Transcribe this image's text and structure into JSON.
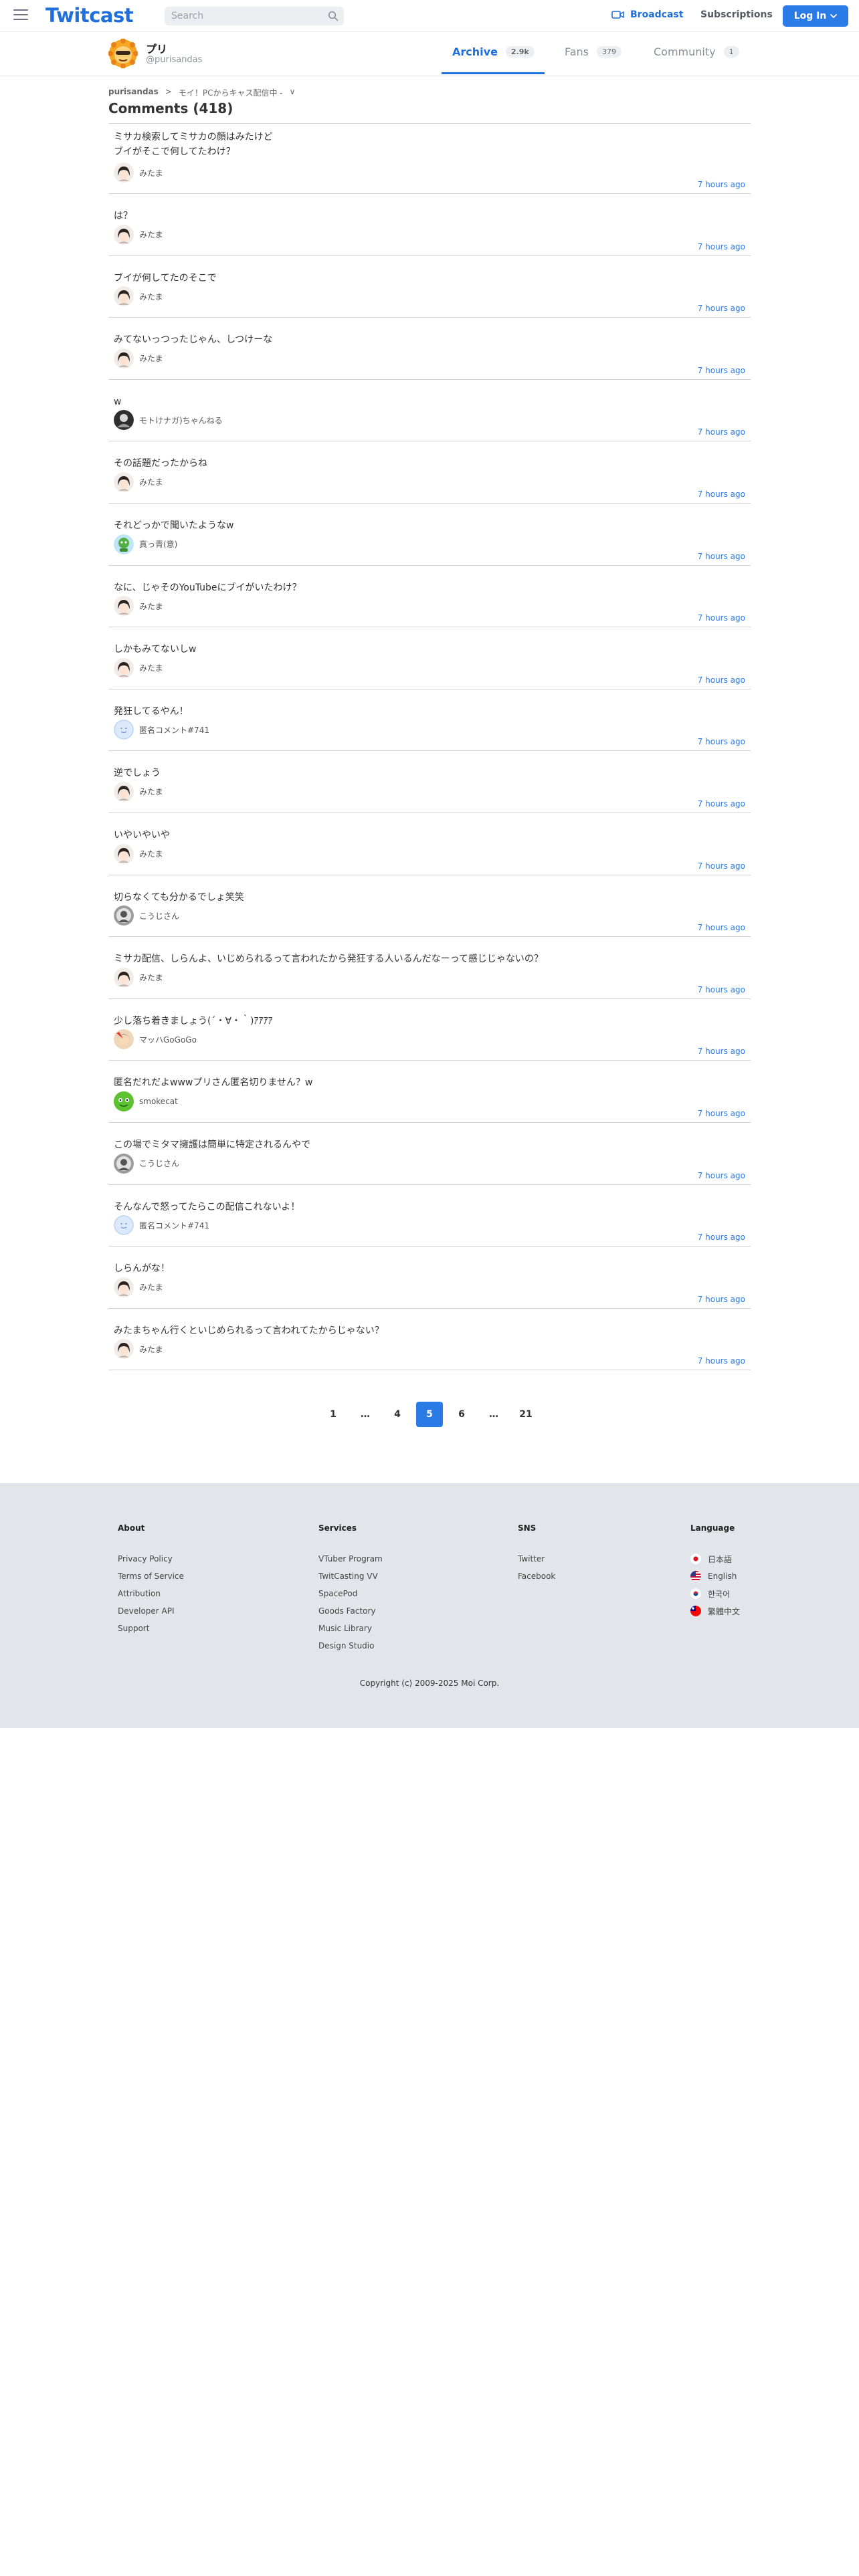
{
  "header": {
    "logo": "Twitcast",
    "search_placeholder": "Search",
    "broadcast_label": "Broadcast",
    "subscriptions_label": "Subscriptions",
    "login_label": "Log In"
  },
  "profile": {
    "name": "プリ",
    "handle": "@purisandas",
    "tabs": [
      {
        "label": "Archive",
        "count": "2.9k"
      },
      {
        "label": "Fans",
        "count": "379"
      },
      {
        "label": "Community",
        "count": "1"
      }
    ]
  },
  "breadcrumb": {
    "user": "purisandas",
    "separator": ">",
    "title": "モイ！PCからキャス配信中 -",
    "chevron": "∨"
  },
  "page_title": "Comments (418)",
  "comments": [
    {
      "text": "ミサカ検索してミサカの顔はみたけど\nブイがそこで何してたわけ？",
      "author": "みたま",
      "time": "7 hours ago",
      "avatar": "mitama"
    },
    {
      "text": "は？",
      "author": "みたま",
      "time": "7 hours ago",
      "avatar": "mitama"
    },
    {
      "text": "ブイが何してたのそこで",
      "author": "みたま",
      "time": "7 hours ago",
      "avatar": "mitama"
    },
    {
      "text": "みてないっつったじゃん、しつけーな",
      "author": "みたま",
      "time": "7 hours ago",
      "avatar": "mitama"
    },
    {
      "text": "w",
      "author": "モトけナガ)ちゃんねる",
      "time": "7 hours ago",
      "avatar": "moto"
    },
    {
      "text": "その話題だったからね",
      "author": "みたま",
      "time": "7 hours ago",
      "avatar": "mitama"
    },
    {
      "text": "それどっかで聞いたようなw",
      "author": "真っ青(意)",
      "time": "7 hours ago",
      "avatar": "massao"
    },
    {
      "text": "なに、じゃそのYouTubeにブイがいたわけ？",
      "author": "みたま",
      "time": "7 hours ago",
      "avatar": "mitama"
    },
    {
      "text": "しかもみてないしw",
      "author": "みたま",
      "time": "7 hours ago",
      "avatar": "mitama"
    },
    {
      "text": "発狂してるやん！",
      "author": "匿名コメント#741",
      "time": "7 hours ago",
      "avatar": "anon"
    },
    {
      "text": "逆でしょう",
      "author": "みたま",
      "time": "7 hours ago",
      "avatar": "mitama"
    },
    {
      "text": "いやいやいや",
      "author": "みたま",
      "time": "7 hours ago",
      "avatar": "mitama"
    },
    {
      "text": "切らなくても分かるでしょ笑笑",
      "author": "こうじさん",
      "time": "7 hours ago",
      "avatar": "kouji"
    },
    {
      "text": "ミサカ配信、しらんよ、いじめられるって言われたから発狂する人いるんだなーって感じじゃないの？",
      "author": "みたま",
      "time": "7 hours ago",
      "avatar": "mitama"
    },
    {
      "text": "少し落ち着きましょう(´・∀・｀)ｱｱｱｱ",
      "author": "マッハGoGoGo",
      "time": "7 hours ago",
      "avatar": "mach"
    },
    {
      "text": "匿名だれだよwwwプリさん匿名切りません？w",
      "author": "smokecat",
      "time": "7 hours ago",
      "avatar": "smoke"
    },
    {
      "text": "この場でミタマ擁護は簡単に特定されるんやで",
      "author": "こうじさん",
      "time": "7 hours ago",
      "avatar": "kouji"
    },
    {
      "text": "そんなんで怒ってたらこの配信これないよ！",
      "author": "匿名コメント#741",
      "time": "7 hours ago",
      "avatar": "anon"
    },
    {
      "text": "しらんがな！",
      "author": "みたま",
      "time": "7 hours ago",
      "avatar": "mitama"
    },
    {
      "text": "みたまちゃん行くといじめられるって言われてたからじゃない？",
      "author": "みたま",
      "time": "7 hours ago",
      "avatar": "mitama"
    }
  ],
  "pagination": {
    "pages": [
      "1",
      "…",
      "4",
      "5",
      "6",
      "…",
      "21"
    ],
    "current": "5"
  },
  "footer": {
    "about": {
      "heading": "About",
      "links": [
        "Privacy Policy",
        "Terms of Service",
        "Attribution",
        "Developer API",
        "Support"
      ]
    },
    "services": {
      "heading": "Services",
      "links": [
        "VTuber Program",
        "TwitCasting VV",
        "SpacePod",
        "Goods Factory",
        "Music Library",
        "Design Studio"
      ]
    },
    "sns": {
      "heading": "SNS",
      "links": [
        "Twitter",
        "Facebook"
      ]
    },
    "language": {
      "heading": "Language",
      "links": [
        "日本語",
        "English",
        "한국어",
        "繁體中文"
      ]
    },
    "copyright": "Copyright (c) 2009-2025 Moi Corp."
  },
  "colors": {
    "accent": "#2a7be6",
    "brand": "#1f6fdc",
    "footer_bg": "#e2e5e9",
    "divider": "#cfd3d8"
  }
}
